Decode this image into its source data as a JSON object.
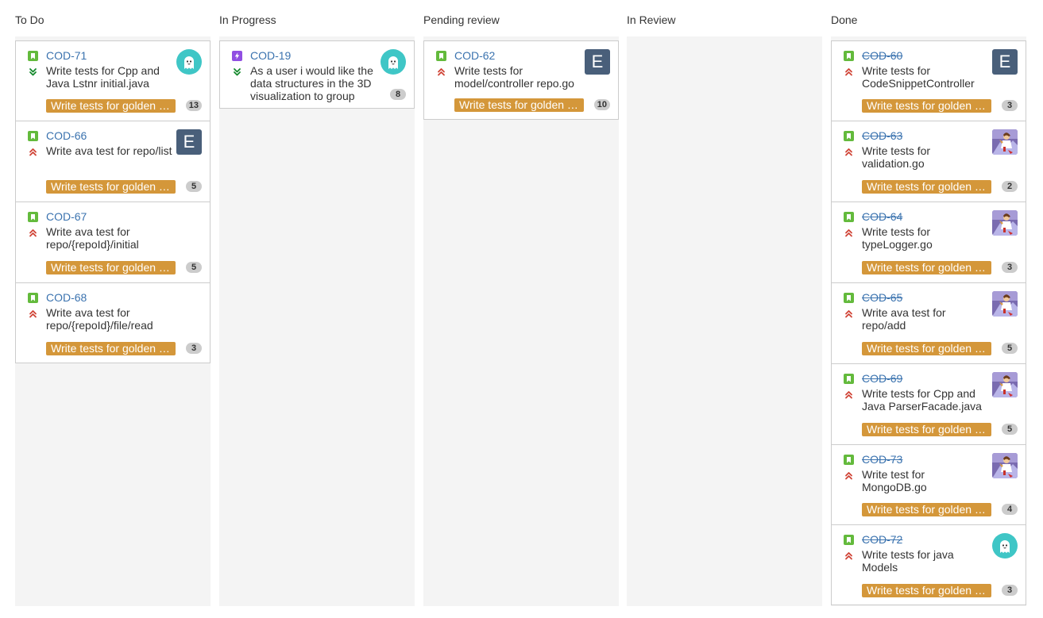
{
  "colors": {
    "column_bg": "#f4f4f4",
    "card_border": "#cccccc",
    "key_link": "#3b73af",
    "epic_bg": "#d4973a",
    "story_icon": "#63ba3c",
    "improvement_icon": "#904ee2",
    "priority_high": "#d04437",
    "priority_low": "#14892c",
    "avatar_ghost": "#3fc6c6",
    "avatar_letter": "#495f7a"
  },
  "columns": [
    {
      "title": "To Do",
      "cards": [
        {
          "key": "COD-71",
          "done": false,
          "type": "story",
          "priority": "low",
          "summary": "Write tests for Cpp and Java Lstnr  initial.java",
          "avatar": "ghost",
          "avatar_letter": "",
          "epic": "Write tests for golden master",
          "points": "13"
        },
        {
          "key": "COD-66",
          "done": false,
          "type": "story",
          "priority": "high",
          "summary": "Write ava test for repo/list",
          "avatar": "letter",
          "avatar_letter": "E",
          "epic": "Write tests for golden master",
          "points": "5"
        },
        {
          "key": "COD-67",
          "done": false,
          "type": "story",
          "priority": "high",
          "summary": "Write ava test for repo/{repoId}/initial",
          "avatar": "none",
          "avatar_letter": "",
          "epic": "Write tests for golden master",
          "points": "5"
        },
        {
          "key": "COD-68",
          "done": false,
          "type": "story",
          "priority": "high",
          "summary": "Write ava test for repo/{repoId}/file/read",
          "avatar": "none",
          "avatar_letter": "",
          "epic": "Write tests for golden master",
          "points": "3"
        }
      ]
    },
    {
      "title": "In Progress",
      "cards": [
        {
          "key": "COD-19",
          "done": false,
          "type": "improvement",
          "priority": "low",
          "summary": "As a user i would like the data structures in the 3D visualization to group",
          "avatar": "ghost",
          "avatar_letter": "",
          "epic": "",
          "points": "8"
        }
      ]
    },
    {
      "title": "Pending review",
      "cards": [
        {
          "key": "COD-62",
          "done": false,
          "type": "story",
          "priority": "high",
          "summary": "Write tests for model/controller repo.go",
          "avatar": "letter",
          "avatar_letter": "E",
          "epic": "Write tests for golden master",
          "points": "10"
        }
      ]
    },
    {
      "title": "In Review",
      "cards": []
    },
    {
      "title": "Done",
      "cards": [
        {
          "key": "COD-60",
          "done": true,
          "type": "story",
          "priority": "high",
          "summary": "Write tests for CodeSnippetController",
          "avatar": "letter",
          "avatar_letter": "E",
          "epic": "Write tests for golden master",
          "points": "3"
        },
        {
          "key": "COD-63",
          "done": true,
          "type": "story",
          "priority": "high",
          "summary": "Write tests for validation.go",
          "avatar": "photo",
          "avatar_letter": "",
          "epic": "Write tests for golden master",
          "points": "2"
        },
        {
          "key": "COD-64",
          "done": true,
          "type": "story",
          "priority": "high",
          "summary": "Write tests for typeLogger.go",
          "avatar": "photo",
          "avatar_letter": "",
          "epic": "Write tests for golden master",
          "points": "3"
        },
        {
          "key": "COD-65",
          "done": true,
          "type": "story",
          "priority": "high",
          "summary": "Write ava test for repo/add",
          "avatar": "photo",
          "avatar_letter": "",
          "epic": "Write tests for golden master",
          "points": "5"
        },
        {
          "key": "COD-69",
          "done": true,
          "type": "story",
          "priority": "high",
          "summary": "Write tests for Cpp and Java ParserFacade.java",
          "avatar": "photo",
          "avatar_letter": "",
          "epic": "Write tests for golden master",
          "points": "5"
        },
        {
          "key": "COD-73",
          "done": true,
          "type": "story",
          "priority": "high",
          "summary": "Write test for MongoDB.go",
          "avatar": "photo",
          "avatar_letter": "",
          "epic": "Write tests for golden master",
          "points": "4"
        },
        {
          "key": "COD-72",
          "done": true,
          "type": "story",
          "priority": "high",
          "summary": "Write tests for java Models",
          "avatar": "ghost",
          "avatar_letter": "",
          "epic": "Write tests for golden master",
          "points": "3"
        }
      ]
    }
  ]
}
